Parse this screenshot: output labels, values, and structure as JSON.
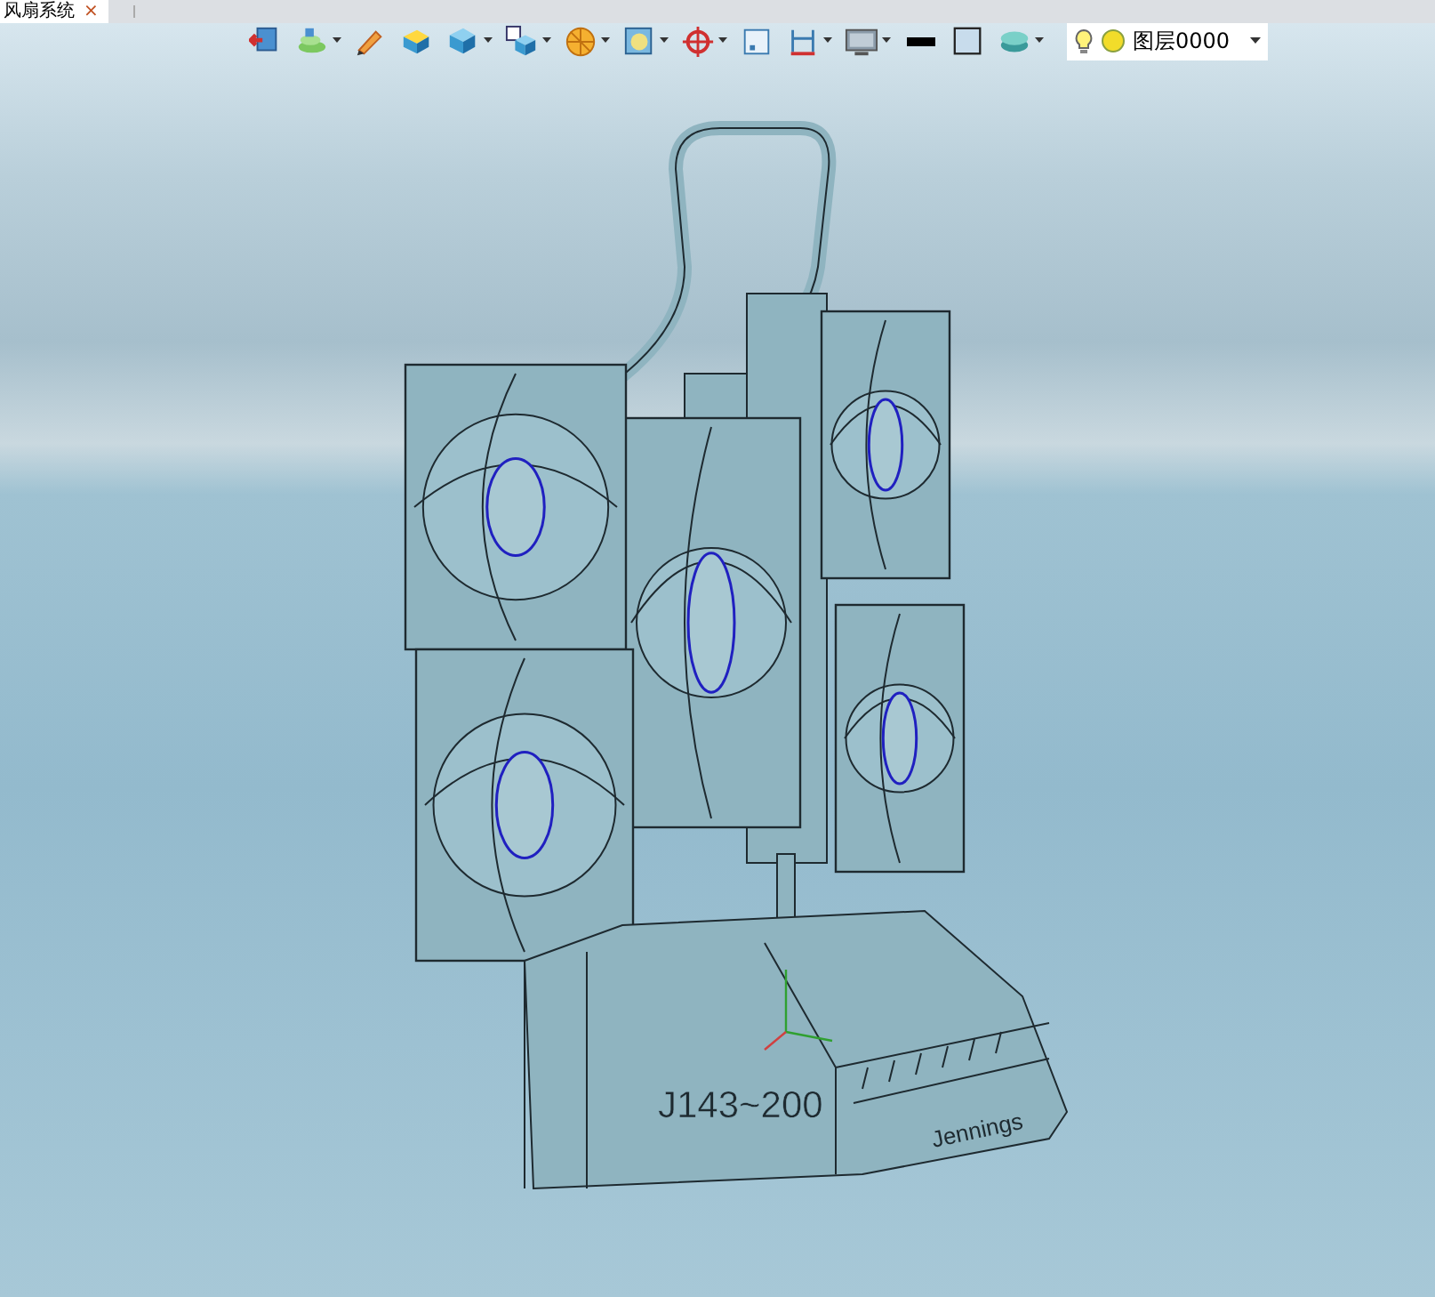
{
  "document_tab": {
    "title": "风扇系统",
    "close": "×",
    "selected": true
  },
  "toolbar": {
    "items": [
      {
        "dropdown": false
      },
      {
        "dropdown": true
      },
      {
        "dropdown": false
      },
      {
        "dropdown": false
      },
      {
        "dropdown": true
      },
      {
        "dropdown": true
      },
      {
        "dropdown": true
      },
      {
        "dropdown": true
      },
      {
        "dropdown": true
      },
      {
        "dropdown": false
      },
      {
        "dropdown": true
      },
      {
        "dropdown": true
      },
      {
        "dropdown": false
      },
      {
        "dropdown": false
      },
      {
        "dropdown": true
      }
    ],
    "layer_combo": {
      "value": "图层0000",
      "light_on": true
    }
  },
  "viewport": {
    "model_labels": [
      "J143~200",
      "Jennings"
    ]
  }
}
